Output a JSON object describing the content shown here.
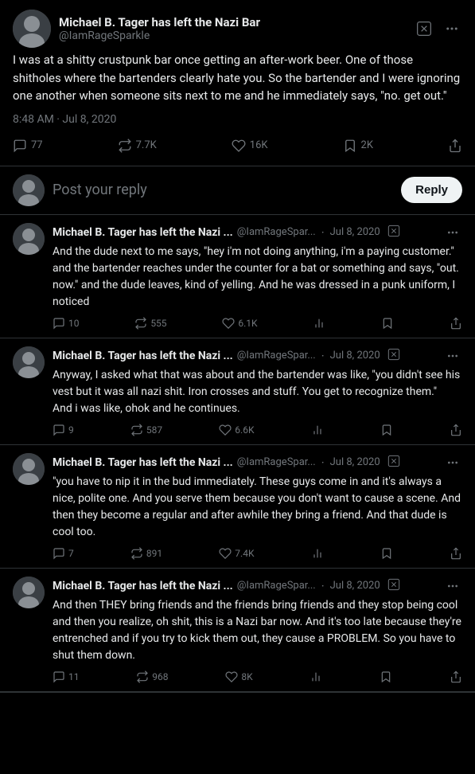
{
  "main_tweet": {
    "display_name": "Michael B. Tager has left the Nazi Bar",
    "handle": "@IamRageSparkle",
    "text": "I was at a shitty crustpunk bar once getting an after-work beer. One of those shitholes where the bartenders clearly hate you. So the bartender and I were ignoring one another when someone sits next to me and he immediately says, \"no. get out.\"",
    "time": "8:48 AM · Jul 8, 2020",
    "stats": {
      "replies": "77",
      "retweets": "7.7K",
      "likes": "16K",
      "bookmarks": "2K"
    }
  },
  "reply_box": {
    "placeholder": "Post your reply",
    "button_label": "Reply"
  },
  "replies": [
    {
      "display_name": "Michael B. Tager has left the Nazi ...",
      "handle": "@IamRageSpar...",
      "date": "Jul 8, 2020",
      "text": "And the dude next to me says, \"hey i'm not doing anything, i'm a paying customer.\" and the bartender reaches under the counter for a bat or something and says, \"out. now.\" and the dude leaves, kind of yelling. And he was dressed in a punk uniform, I noticed",
      "stats": {
        "replies": "10",
        "retweets": "555",
        "likes": "6.1K"
      }
    },
    {
      "display_name": "Michael B. Tager has left the Nazi ...",
      "handle": "@IamRageSpar...",
      "date": "Jul 8, 2020",
      "text": "Anyway, I asked what that was about and the bartender was like, \"you didn't see his vest but it was all nazi shit. Iron crosses and stuff. You get to recognize them.\"\n\nAnd i was like, ohok and he continues.",
      "stats": {
        "replies": "9",
        "retweets": "587",
        "likes": "6.6K"
      }
    },
    {
      "display_name": "Michael B. Tager has left the Nazi ...",
      "handle": "@IamRageSpar...",
      "date": "Jul 8, 2020",
      "text": "\"you have to nip it in the bud immediately. These guys come in and it's always a nice, polite one. And you serve them because you don't want to cause a scene. And then they become a regular and after awhile they bring a friend. And that dude is cool too.",
      "stats": {
        "replies": "7",
        "retweets": "891",
        "likes": "7.4K"
      }
    },
    {
      "display_name": "Michael B. Tager has left the Nazi ...",
      "handle": "@IamRageSpar...",
      "date": "Jul 8, 2020",
      "text": "And then THEY bring friends and the friends bring friends and they stop being cool and then you realize, oh shit, this is a Nazi bar now. And it's too late because they're entrenched and if you try to kick them out, they cause a PROBLEM. So you have to shut them down.",
      "stats": {
        "replies": "11",
        "retweets": "968",
        "likes": "8K"
      }
    }
  ],
  "colors": {
    "bg": "#000000",
    "text": "#e7e9ea",
    "secondary": "#71767b",
    "border": "#2f3336",
    "accent": "#1d9bf0",
    "reply_btn_bg": "#eff3f4",
    "reply_btn_text": "#0f1419"
  }
}
